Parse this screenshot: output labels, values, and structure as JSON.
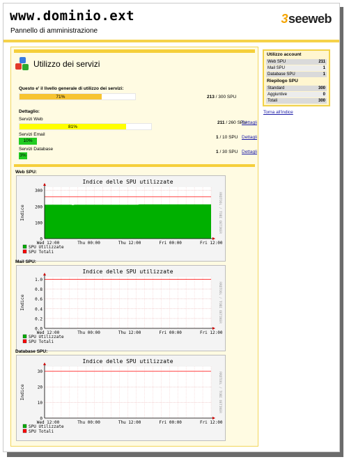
{
  "header": {
    "site_title": "www.dominio.ext",
    "site_subtitle": "Pannello di amministrazione",
    "logo_text": "seeweb",
    "logo_mark": "3"
  },
  "panel": {
    "title": "Utilizzo dei servizi",
    "overall_label": "Questo e' il livello generale di utilizzo dei servizi:",
    "overall": {
      "percent": 71,
      "percent_text": "71%",
      "used": "213",
      "total": "/ 300 SPU"
    },
    "detail_label": "Dettaglio:",
    "services": [
      {
        "name": "Servizi Web",
        "percent": 81,
        "percent_text": "81%",
        "used": "211",
        "total": "/ 260 SPU",
        "link": "Dettagli",
        "color": "#ffff00"
      },
      {
        "name": "Servizi Email",
        "percent": 10,
        "percent_text": "10%",
        "used": "1",
        "total": "/ 10 SPU",
        "link": "Dettagli",
        "color": "#22cc22"
      },
      {
        "name": "Servizi Database",
        "percent": 3,
        "percent_text": "3%",
        "used": "1",
        "total": "/ 30 SPU",
        "link": "Dettagli",
        "color": "#22cc22"
      }
    ]
  },
  "graphs": [
    {
      "section_label": "Web SPU:",
      "chart_data": {
        "type": "area",
        "title": "Indice delle SPU utilizzate",
        "ylabel": "Indice",
        "side_label": "RRDTOOL / TOBI OETIKER",
        "x_ticks": [
          "Wed 12:00",
          "Thu 00:00",
          "Thu 12:00",
          "Fri 00:00",
          "Fri 12:00"
        ],
        "y_ticks": [
          "0",
          "100",
          "200",
          "300"
        ],
        "ylim": [
          0,
          320
        ],
        "series": [
          {
            "name": "SPU Utilizzate",
            "color": "#00b000",
            "x_fraction": [
              0,
              0.16,
              0.17,
              0.18,
              0.56,
              0.57,
              1
            ],
            "values": [
              211,
              211,
              208,
              211,
              211,
              213,
              213
            ]
          },
          {
            "name": "SPU Totali",
            "color": "#ff0000",
            "line_value": 260
          }
        ]
      }
    },
    {
      "section_label": "Mail SPU:",
      "chart_data": {
        "type": "area",
        "title": "Indice delle SPU utilizzate",
        "ylabel": "Indice",
        "side_label": "RRDTOOL / TOBI OETIKER",
        "x_ticks": [
          "Wed 12:00",
          "Thu 00:00",
          "Thu 12:00",
          "Fri 00:00",
          "Fri 12:00"
        ],
        "y_ticks": [
          "0.0",
          "0.2",
          "0.4",
          "0.6",
          "0.8",
          "1.0"
        ],
        "ylim": [
          0,
          1.05
        ],
        "series": [
          {
            "name": "SPU Utilizzate",
            "color": "#00b000",
            "values": []
          },
          {
            "name": "SPU Totali",
            "color": "#ff0000",
            "line_value": 1.0
          }
        ]
      }
    },
    {
      "section_label": "Database SPU:",
      "chart_data": {
        "type": "area",
        "title": "Indice delle SPU utilizzate",
        "ylabel": "Indice",
        "side_label": "RRDTOOL / TOBI OETIKER",
        "x_ticks": [
          "Wed 12:00",
          "Thu 00:00",
          "Thu 12:00",
          "Fri 00:00",
          "Fri 12:00"
        ],
        "y_ticks": [
          "0",
          "10",
          "20",
          "30"
        ],
        "ylim": [
          0,
          33
        ],
        "series": [
          {
            "name": "SPU Utilizzate",
            "color": "#00b000",
            "values": []
          },
          {
            "name": "SPU Totali",
            "color": "#ff0000",
            "line_value": 30
          }
        ]
      }
    }
  ],
  "sidebar": {
    "account_title": "Utilizzo account",
    "account_rows": [
      {
        "label": "Web SPU",
        "value": "211"
      },
      {
        "label": "Mail SPU",
        "value": "1"
      },
      {
        "label": "Database SPU",
        "value": "1"
      }
    ],
    "summary_title": "Riepilogo SPU",
    "summary_rows": [
      {
        "label": "Standard",
        "value": "300"
      },
      {
        "label": "Aggiuntive",
        "value": "0"
      },
      {
        "label": "Totali",
        "value": "300"
      }
    ],
    "back_link": "Torna all'indice"
  }
}
